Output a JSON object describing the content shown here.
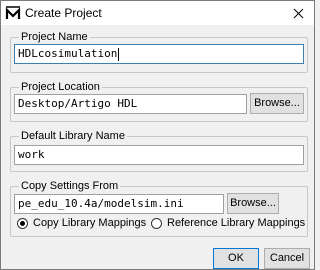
{
  "window": {
    "title": "Create Project",
    "icon": "modelsim-M-icon"
  },
  "project_name": {
    "legend": "Project Name",
    "value": "HDLcosimulation"
  },
  "project_location": {
    "legend": "Project Location",
    "value": "Desktop/Artigo HDL",
    "browse_label": "Browse..."
  },
  "default_library": {
    "legend": "Default Library Name",
    "value": "work"
  },
  "copy_settings": {
    "legend": "Copy Settings From",
    "value": "pe_edu_10.4a/modelsim.ini",
    "browse_label": "Browse...",
    "options": [
      {
        "label": "Copy Library Mappings",
        "selected": true
      },
      {
        "label": "Reference Library Mappings",
        "selected": false
      }
    ]
  },
  "buttons": {
    "ok": "OK",
    "cancel": "Cancel"
  },
  "colors": {
    "focus_border": "#3c7fb1",
    "default_button_border": "#0078d7",
    "background": "#f0f0f0"
  }
}
